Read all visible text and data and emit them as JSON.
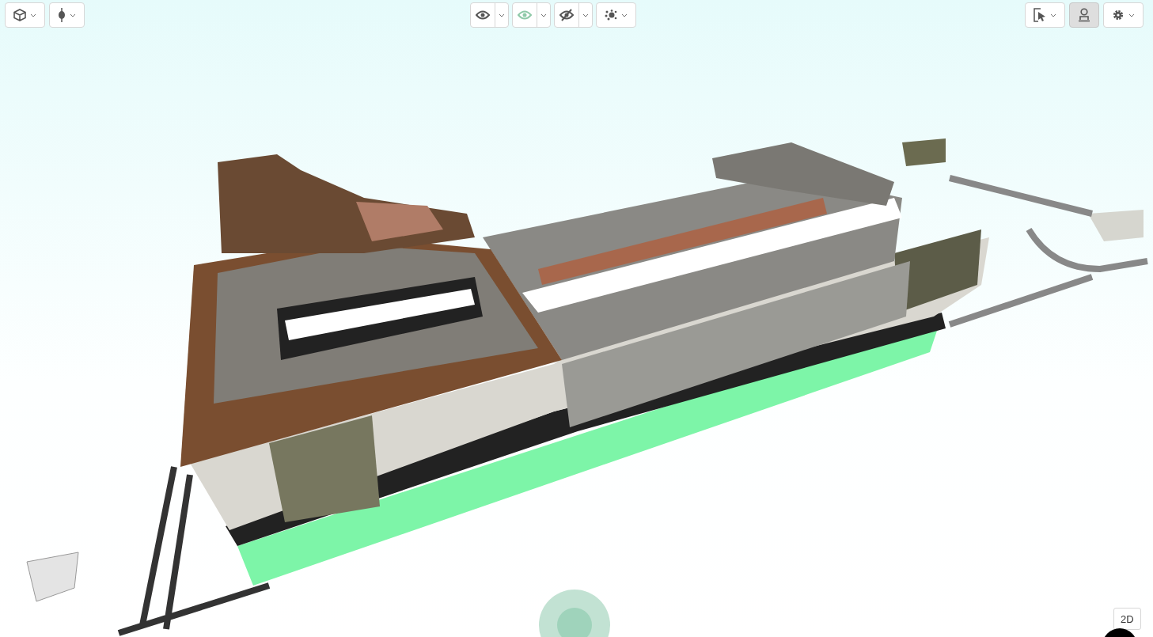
{
  "toolbar_left": [
    {
      "kind": "cube",
      "selected": false
    },
    {
      "kind": "pin",
      "selected": false
    }
  ],
  "toolbar_center": [
    {
      "kind": "eye",
      "selected": false
    },
    {
      "kind": "eye-green",
      "selected": false
    },
    {
      "kind": "eye-off",
      "selected": false
    },
    {
      "kind": "explode",
      "selected": false
    }
  ],
  "toolbar_right": [
    {
      "kind": "select",
      "selected": false
    },
    {
      "kind": "person",
      "selected": true
    },
    {
      "kind": "settings",
      "selected": false
    }
  ],
  "view_toggle": {
    "label": "2D"
  }
}
